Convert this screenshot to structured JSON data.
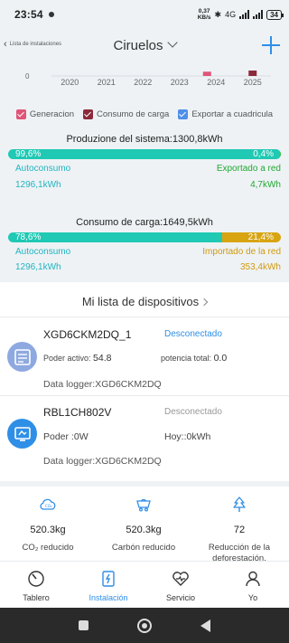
{
  "status_bar": {
    "time": "23:54",
    "net_speed_value": "0,37",
    "net_speed_unit": "KB/s",
    "network": "4G",
    "battery": "34"
  },
  "header": {
    "back_label": "Lista de instalaciones",
    "title": "Ciruelos"
  },
  "chart_data": {
    "type": "bar",
    "categories": [
      "2020",
      "2021",
      "2022",
      "2023",
      "2024",
      "2025"
    ],
    "series": [
      {
        "name": "Generacion",
        "color": "#e05477",
        "values": [
          0,
          0,
          0,
          0,
          1300.8,
          0
        ]
      },
      {
        "name": "Consumo de carga",
        "color": "#8b2a3b",
        "values": [
          0,
          0,
          0,
          0,
          0,
          1649.5
        ]
      },
      {
        "name": "Exportar a cuadricula",
        "color": "#4f8fe8",
        "values": [
          0,
          0,
          0,
          0,
          0,
          0
        ]
      }
    ],
    "y_visible_label": "0"
  },
  "production": {
    "title": "Produzione del sistema:1300,8kWh",
    "left_pct": "99,6%",
    "right_pct": "0,4%",
    "left_fraction": 0.996,
    "left_label": "Autoconsumo",
    "right_label": "Exportado a red",
    "left_value": "1296,1kWh",
    "right_value": "4,7kWh",
    "left_color": "#1fc9b4",
    "right_color": "#2ebf3f"
  },
  "consumption": {
    "title": "Consumo de carga:1649,5kWh",
    "left_pct": "78,6%",
    "right_pct": "21,4%",
    "left_fraction": 0.786,
    "left_label": "Autoconsumo",
    "right_label": "Importado de la red",
    "left_value": "1296,1kWh",
    "right_value": "353,4kWh",
    "left_color": "#1fc9b4",
    "right_color": "#d8a412"
  },
  "devices": {
    "title": "Mi lista de dispositivos",
    "items": [
      {
        "name": "XGD6CKM2DQ_1",
        "status": "Desconectado",
        "kv1_label": "Poder activo:",
        "kv1_value": "54.8",
        "kv2_label": "potencia total:",
        "kv2_value": "0.0",
        "logger": "Data logger:XGD6CKM2DQ",
        "icon": "inverter-icon"
      },
      {
        "name": "RBL1CH802V",
        "status": "Desconectado",
        "kv1_label": "Poder :0W",
        "kv2_label": "Hoy::0kWh",
        "logger": "Data logger:XGD6CKM2DQ",
        "icon": "monitor-icon"
      }
    ]
  },
  "stats": [
    {
      "value": "520.3kg",
      "caption": "CO₂ reducido",
      "icon": "cloud-icon"
    },
    {
      "value": "520.3kg",
      "caption": "Carbón reducido",
      "icon": "coal-cart-icon"
    },
    {
      "value": "72",
      "caption": "Reducción de la deforestación.",
      "icon": "tree-icon"
    }
  ],
  "nav": [
    {
      "label": "Tablero",
      "icon": "dashboard-icon"
    },
    {
      "label": "Instalación",
      "icon": "installation-icon",
      "active": true
    },
    {
      "label": "Servicio",
      "icon": "service-icon"
    },
    {
      "label": "Yo",
      "icon": "user-icon"
    }
  ],
  "colors": {
    "accent": "#2f8fe6",
    "panel_bg": "#eef2f5",
    "connected_status": "#2f8fe6",
    "disconnected_status": "#999999"
  }
}
